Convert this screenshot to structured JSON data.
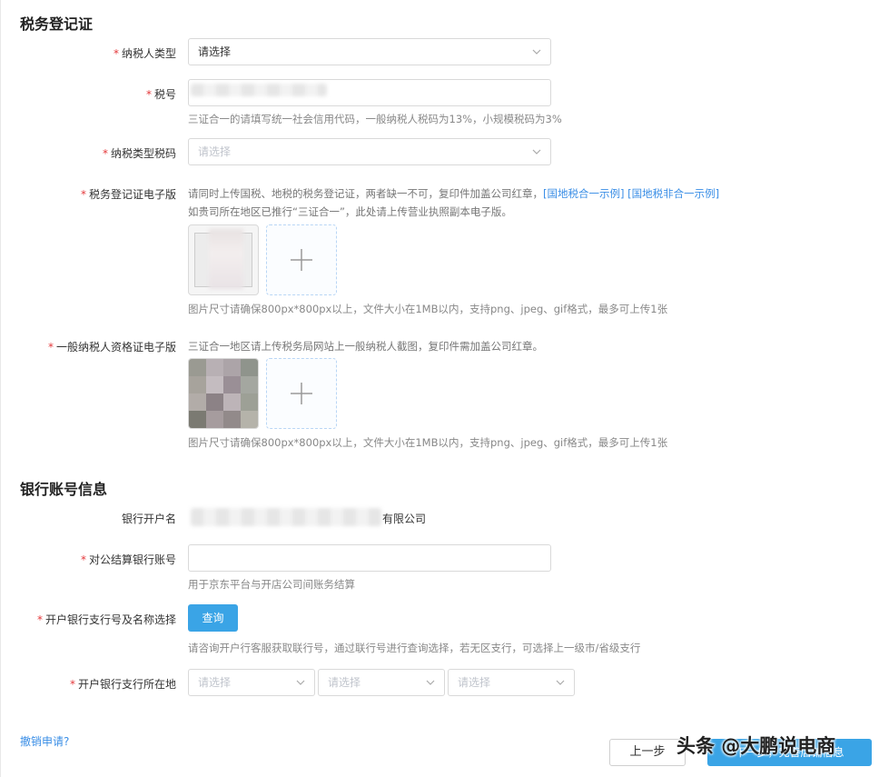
{
  "tax_section": {
    "title": "税务登记证",
    "taxpayer_type": {
      "label": "纳税人类型",
      "value": "请选择"
    },
    "tax_number": {
      "label": "税号",
      "hint": "三证合一的请填写统一社会信用代码，一般纳税人税码为13%，小规模税码为3%"
    },
    "tax_type_code": {
      "label": "纳税类型税码",
      "placeholder": "请选择"
    },
    "tax_cert": {
      "label": "税务登记证电子版",
      "hint_line1": "请同时上传国税、地税的税务登记证，两者缺一不可，复印件加盖公司红章，",
      "example1": "国地税合一示例",
      "example2": "国地税非合一示例",
      "hint_line2": "如贵司所在地区已推行“三证合一”，此处请上传营业执照副本电子版。",
      "size_hint": "图片尺寸请确保800px*800px以上，文件大小在1MB以内，支持png、jpeg、gif格式，最多可上传1张"
    },
    "general_taxpayer_cert": {
      "label": "一般纳税人资格证电子版",
      "hint": "三证合一地区请上传税务局网站上一般纳税人截图，复印件需加盖公司红章。",
      "size_hint": "图片尺寸请确保800px*800px以上，文件大小在1MB以内，支持png、jpeg、gif格式，最多可上传1张"
    }
  },
  "bank_section": {
    "title": "银行账号信息",
    "account_name": {
      "label": "银行开户名",
      "value_suffix": "有限公司"
    },
    "settlement_account": {
      "label": "对公结算银行账号",
      "hint": "用于京东平台与开店公司间账务结算"
    },
    "branch_select": {
      "label": "开户银行支行号及名称选择",
      "button": "查询",
      "hint": "请咨询开户行客服获取联行号，通过联行号进行查询选择，若无区支行，可选择上一级市/省级支行"
    },
    "branch_location": {
      "label": "开户银行支行所在地",
      "placeholders": [
        "请选择",
        "请选择",
        "请选择"
      ]
    }
  },
  "footer": {
    "cancel_link": "撤销申请?",
    "prev_button": "上一步",
    "next_button": "下一步，完善店铺信息",
    "watermark": "头条 @大鹏说电商"
  },
  "colors": {
    "primary": "#3aa4e6",
    "required": "#e4393c",
    "link": "#3a8ee6"
  }
}
